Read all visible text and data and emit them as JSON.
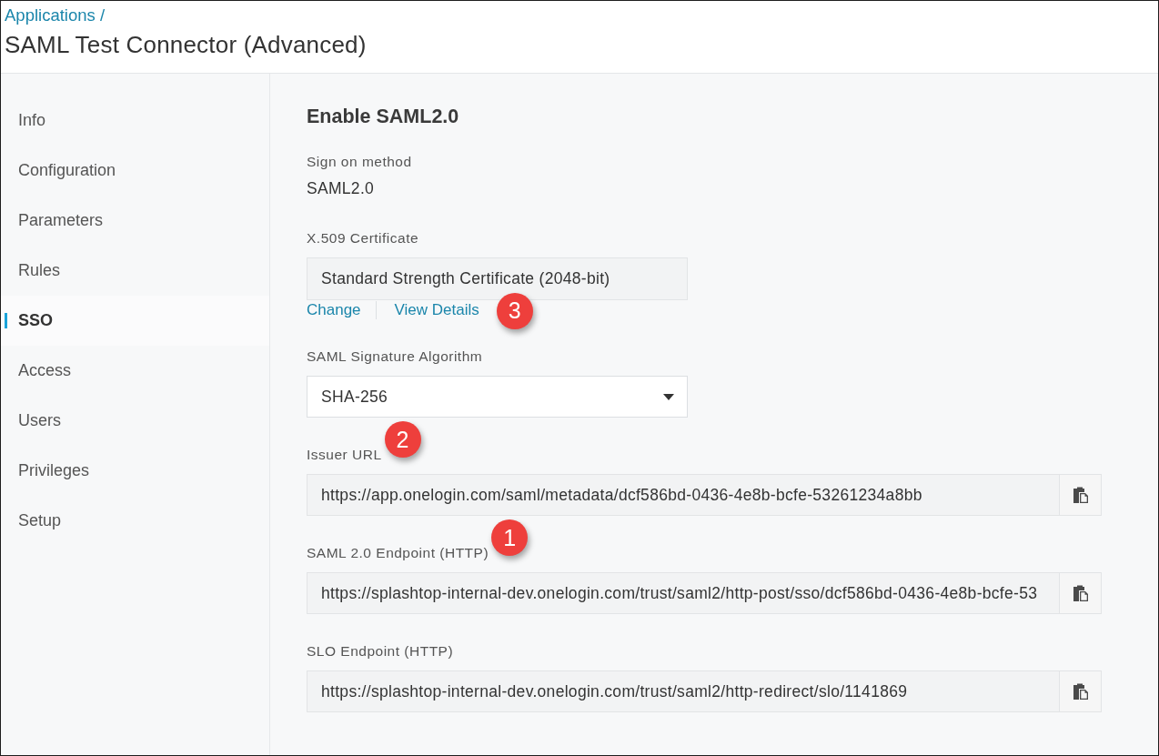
{
  "header": {
    "breadcrumb": "Applications /",
    "title": "SAML Test Connector (Advanced)"
  },
  "sidebar": {
    "items": [
      {
        "label": "Info",
        "selected": false
      },
      {
        "label": "Configuration",
        "selected": false
      },
      {
        "label": "Parameters",
        "selected": false
      },
      {
        "label": "Rules",
        "selected": false
      },
      {
        "label": "SSO",
        "selected": true
      },
      {
        "label": "Access",
        "selected": false
      },
      {
        "label": "Users",
        "selected": false
      },
      {
        "label": "Privileges",
        "selected": false
      },
      {
        "label": "Setup",
        "selected": false
      }
    ]
  },
  "section": {
    "title": "Enable SAML2.0",
    "fields": [
      {
        "kind": "static",
        "label": "Sign on method",
        "value": "SAML2.0"
      },
      {
        "kind": "certificate",
        "label": "X.509 Certificate",
        "value": "Standard Strength Certificate (2048-bit)",
        "links": [
          "Change",
          "View Details"
        ],
        "callout": "3"
      },
      {
        "kind": "select",
        "label": "SAML Signature Algorithm",
        "value": "SHA-256"
      },
      {
        "kind": "copy",
        "label": "Issuer URL",
        "value": "https://app.onelogin.com/saml/metadata/dcf586bd-0436-4e8b-bcfe-53261234a8bb",
        "callout": "2"
      },
      {
        "kind": "copy",
        "label": "SAML 2.0 Endpoint (HTTP)",
        "value": "https://splashtop-internal-dev.onelogin.com/trust/saml2/http-post/sso/dcf586bd-0436-4e8b-bcfe-53",
        "callout": "1"
      },
      {
        "kind": "copy",
        "label": "SLO Endpoint (HTTP)",
        "value": "https://splashtop-internal-dev.onelogin.com/trust/saml2/http-redirect/slo/1141869"
      }
    ]
  }
}
